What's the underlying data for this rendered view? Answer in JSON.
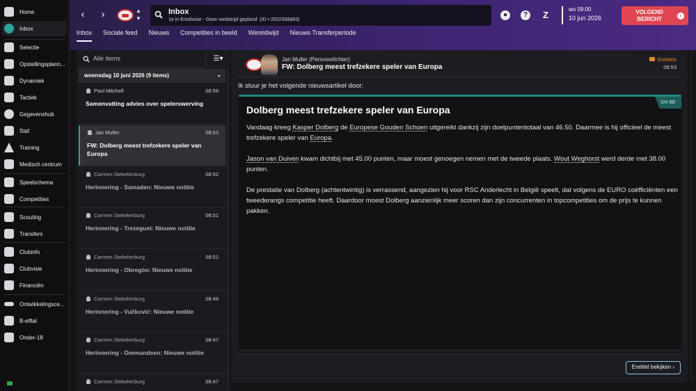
{
  "sidebar": {
    "items": [
      {
        "label": "Home",
        "icon": "home-icon"
      },
      {
        "label": "Inbox",
        "icon": "inbox-icon",
        "active": true
      },
      {
        "label": "Selectie",
        "icon": "shirt-icon"
      },
      {
        "label": "Opstellingsplann...",
        "icon": "clipboard-icon"
      },
      {
        "label": "Dynamiek",
        "icon": "handshake-icon"
      },
      {
        "label": "Tactiek",
        "icon": "tactics-board-icon"
      },
      {
        "label": "Gegevenshub",
        "icon": "data-hub-icon"
      },
      {
        "label": "Staf",
        "icon": "staff-icon"
      },
      {
        "label": "Training",
        "icon": "training-cone-icon"
      },
      {
        "label": "Medisch centrum",
        "icon": "medical-cross-icon"
      },
      {
        "label": "Speelschema",
        "icon": "calendar-icon"
      },
      {
        "label": "Competities",
        "icon": "trophy-icon"
      },
      {
        "label": "Scouting",
        "icon": "binoculars-icon"
      },
      {
        "label": "Transfers",
        "icon": "transfer-arrows-icon"
      },
      {
        "label": "Clubinfo",
        "icon": "shield-icon"
      },
      {
        "label": "Clubvisie",
        "icon": "vision-icon"
      },
      {
        "label": "Financiën",
        "icon": "money-icon"
      },
      {
        "label": "Ontwikkelingsce...",
        "icon": "development-icon"
      },
      {
        "label": "B-elftal",
        "icon": "team-icon"
      },
      {
        "label": "Onder-18",
        "icon": "youth-team-icon"
      }
    ]
  },
  "header": {
    "title": "Inbox",
    "subtitle": "1e in Eredivisie - Geen wedstrijd gepland. (ID r-2002068883)",
    "back_label": "‹",
    "forward_label": "›",
    "date_time": "wo 09:00",
    "date_day": "10 jun 2026",
    "continue_label": "VOLGEND BERICHT",
    "colors": {
      "gradient_start": "#2a1e49",
      "gradient_end": "#4b2a83",
      "continue": "#e04651"
    }
  },
  "tabs": [
    {
      "label": "Inbox",
      "active": true
    },
    {
      "label": "Sociale feed"
    },
    {
      "label": "Nieuws"
    },
    {
      "label": "Competities in beeld"
    },
    {
      "label": "Wereldwijd"
    },
    {
      "label": "Nieuws Transferperiode"
    }
  ],
  "list": {
    "search_placeholder": "Alle items",
    "group_header": "woensdag 10 juni 2026 (9 items)",
    "messages": [
      {
        "sender": "Paul Mitchell",
        "time": "08:56",
        "subject": "Samenvatting advies over spelerswerving",
        "read": false
      },
      {
        "sender": "Jan Muller",
        "time": "08:53",
        "subject": "FW: Dolberg meest trefzekere speler van Europa",
        "read": false,
        "selected": true
      },
      {
        "sender": "Carmen Stekelenburg",
        "time": "08:52",
        "subject": "Herinnering - Samaden: Nieuwe notitie",
        "read": true
      },
      {
        "sender": "Carmen Stekelenburg",
        "time": "08:51",
        "subject": "Herinnering - Trezeguet: Nieuwe notitie",
        "read": true
      },
      {
        "sender": "Carmen Stekelenburg",
        "time": "08:51",
        "subject": "Herinnering - Obregón: Nieuwe notitie",
        "read": true
      },
      {
        "sender": "Carmen Stekelenburg",
        "time": "08:49",
        "subject": "Herinnering - Vučković: Nieuwe notitie",
        "read": true
      },
      {
        "sender": "Carmen Stekelenburg",
        "time": "08:47",
        "subject": "Herinnering - Ommundsen: Nieuwe notitie",
        "read": true
      },
      {
        "sender": "Carmen Stekelenburg",
        "time": "08:47",
        "subject": "",
        "read": true
      }
    ]
  },
  "message": {
    "from": "Jan Muller  (Persvoorlichter)",
    "subject": "FW: Dolberg meest trefzekere speler van Europa",
    "category": "Eretitels",
    "time": "08:53",
    "intro": "Ik stuur je het volgende nieuwsartikel door:",
    "article": {
      "tag": "DH BE",
      "title": "Dolberg meest trefzekere speler van Europa",
      "p1": {
        "a": "Vandaag kreeg ",
        "player": "Kasper Dolberg",
        "b": " de ",
        "award": "Europese Gouden Schoen",
        "c": " uitgereikt dankzij zijn doelpuntentotaal van 46.50. Daarmee is hij officieel de meest trefzekere speler van ",
        "region": "Europa",
        "d": "."
      },
      "p2": {
        "player1": "Jason van Duiven",
        "a": " kwam dichtbij met 45.00 punten, maar moest genoegen nemen met de tweede plaats. ",
        "player2": "Wout Weghorst",
        "b": " werd derde met 38.00 punten."
      },
      "p3": "De prestatie van Dolberg (achtentwintig) is verrassend, aangezien hij voor RSC Anderlecht in België speelt, dat volgens de EURO coëfficiënten een tweederangs competitie heeft. Daardoor moest Dolberg aanzienlijk meer scoren dan zijn concurrenten in topcompetities om de prijs te kunnen pakken."
    },
    "rating_button": "Eretitel bekijken ›",
    "colors": {
      "accent": "#1f8a82",
      "category": "#e48a2c"
    }
  }
}
